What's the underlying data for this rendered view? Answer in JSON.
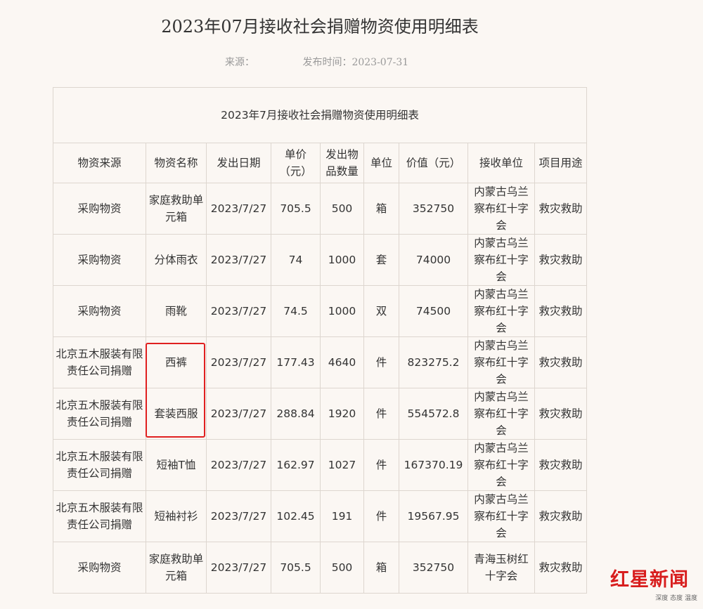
{
  "page": {
    "title": "2023年07月接收社会捐赠物资使用明细表",
    "source_label": "来源：",
    "publish_label": "发布时间：2023-07-31"
  },
  "table": {
    "caption": "2023年7月接收社会捐赠物资使用明细表",
    "headers": [
      "物资来源",
      "物资名称",
      "发出日期",
      "单价（元）",
      "发出物品数量",
      "单位",
      "价值（元）",
      "接收单位",
      "项目用途"
    ],
    "rows": [
      [
        "采购物资",
        "家庭救助单元箱",
        "2023/7/27",
        "705.5",
        "500",
        "箱",
        "352750",
        "内蒙古乌兰察布红十字会",
        "救灾救助"
      ],
      [
        "采购物资",
        "分体雨衣",
        "2023/7/27",
        "74",
        "1000",
        "套",
        "74000",
        "内蒙古乌兰察布红十字会",
        "救灾救助"
      ],
      [
        "采购物资",
        "雨靴",
        "2023/7/27",
        "74.5",
        "1000",
        "双",
        "74500",
        "内蒙古乌兰察布红十字会",
        "救灾救助"
      ],
      [
        "北京五木服装有限责任公司捐赠",
        "西裤",
        "2023/7/27",
        "177.43",
        "4640",
        "件",
        "823275.2",
        "内蒙古乌兰察布红十字会",
        "救灾救助"
      ],
      [
        "北京五木服装有限责任公司捐赠",
        "套装西服",
        "2023/7/27",
        "288.84",
        "1920",
        "件",
        "554572.8",
        "内蒙古乌兰察布红十字会",
        "救灾救助"
      ],
      [
        "北京五木服装有限责任公司捐赠",
        "短袖T恤",
        "2023/7/27",
        "162.97",
        "1027",
        "件",
        "167370.19",
        "内蒙古乌兰察布红十字会",
        "救灾救助"
      ],
      [
        "北京五木服装有限责任公司捐赠",
        "短袖衬衫",
        "2023/7/27",
        "102.45",
        "191",
        "件",
        "19567.95",
        "内蒙古乌兰察布红十字会",
        "救灾救助"
      ],
      [
        "采购物资",
        "家庭救助单元箱",
        "2023/7/27",
        "705.5",
        "500",
        "箱",
        "352750",
        "青海玉树红十字会",
        "救灾救助"
      ]
    ]
  },
  "logo": {
    "main": "红星新闻",
    "sub": "深度 态度 温度"
  },
  "colors": {
    "background": "#fbf7f3",
    "highlight": "#e02020",
    "brand": "#d81e1e"
  }
}
